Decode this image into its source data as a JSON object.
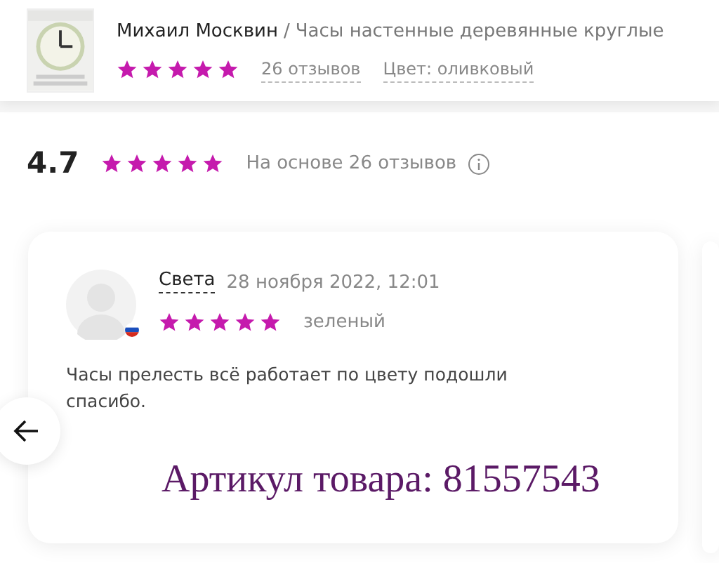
{
  "product": {
    "seller": "Михаил Москвин",
    "separator": "/",
    "title": "Часы настенные деревянные круглые",
    "stars": 5,
    "reviews_count": "26 отзывов",
    "color_label": "Цвет: оливковый"
  },
  "summary": {
    "rating": "4.7",
    "stars": 5,
    "basis": "На основе 26 отзывов"
  },
  "review": {
    "author": "Света",
    "date": "28 ноября 2022, 12:01",
    "stars": 5,
    "variant": "зеленый",
    "text": "Часы прелесть всё работает по цвету подошли спасибо."
  },
  "overlay_caption": "Артикул товара: 81557543"
}
